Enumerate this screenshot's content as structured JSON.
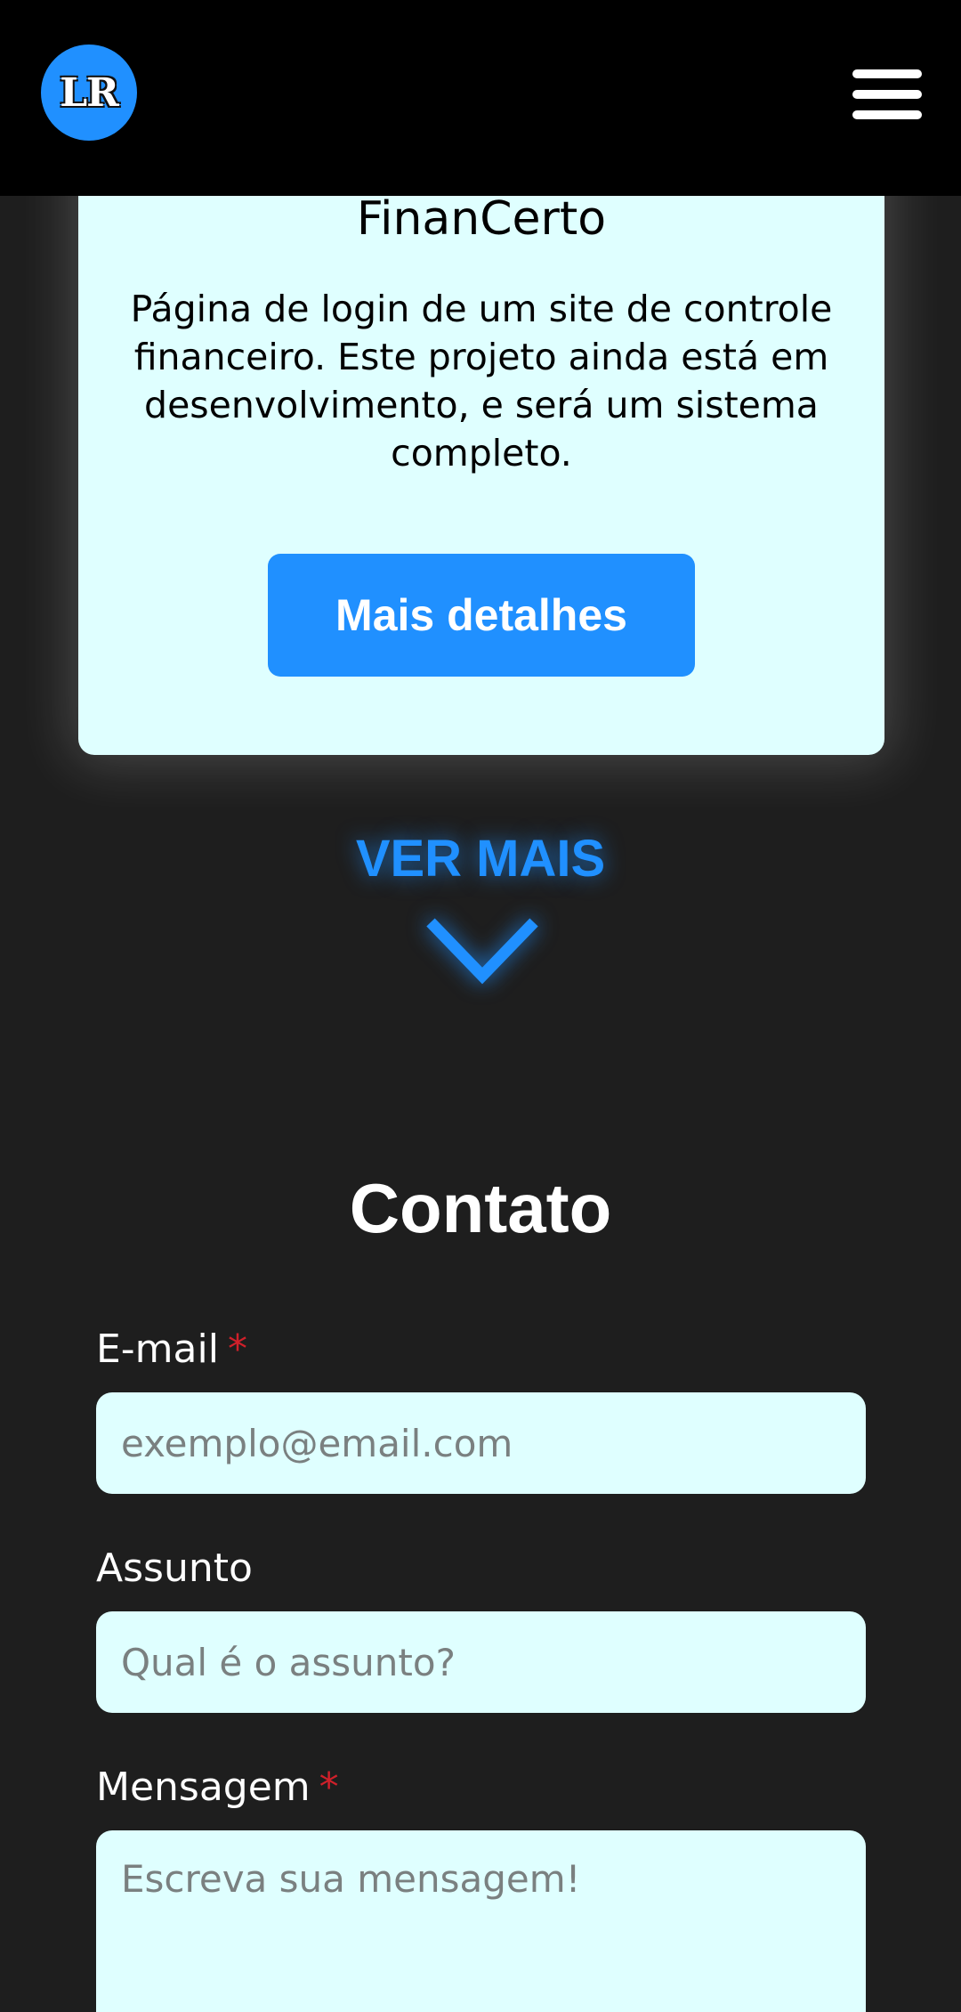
{
  "header": {
    "logo_text": "LR",
    "menu_icon": "hamburger-menu-icon"
  },
  "card": {
    "title": "FinanCerto",
    "description": "Página de login de um site de controle financeiro. Este projeto ainda está em desenvolvimento, e será um sistema completo.",
    "button_label": "Mais detalhes"
  },
  "ver_mais": {
    "label": "VER MAIS",
    "icon": "chevron-down-icon"
  },
  "contact": {
    "title": "Contato",
    "email": {
      "label": "E-mail",
      "required_mark": "*",
      "placeholder": "exemplo@email.com"
    },
    "subject": {
      "label": "Assunto",
      "placeholder": "Qual é o assunto?"
    },
    "message": {
      "label": "Mensagem",
      "required_mark": "*",
      "placeholder": "Escreva sua mensagem!"
    }
  },
  "colors": {
    "accent": "#2090ff",
    "card_bg": "#dfffff",
    "page_bg": "#1e1e1e",
    "header_bg": "#000000",
    "required": "#d0202a"
  }
}
